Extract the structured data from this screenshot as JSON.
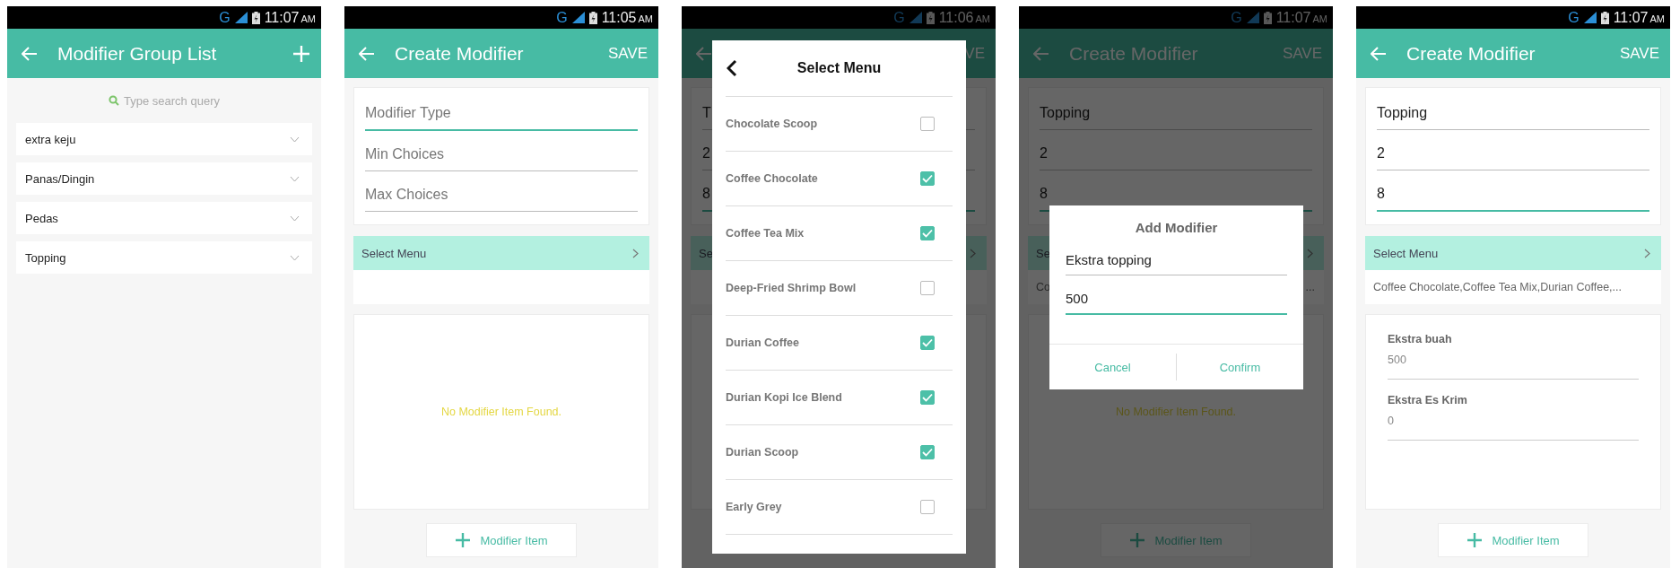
{
  "screens": [
    {
      "kind": "group_list",
      "status_bar": {
        "network": "G",
        "time": "11:07",
        "ampm": "AM"
      },
      "app_bar": {
        "title": "Modifier Group List",
        "action": {
          "kind": "add"
        }
      },
      "search": {
        "placeholder": "Type search query"
      },
      "groups": [
        {
          "name": "extra keju"
        },
        {
          "name": "Panas/Dingin"
        },
        {
          "name": "Pedas"
        },
        {
          "name": "Topping"
        }
      ]
    },
    {
      "kind": "form",
      "status_bar": {
        "network": "G",
        "time": "11:05",
        "ampm": "AM"
      },
      "app_bar": {
        "title": "Create Modifier",
        "action": {
          "kind": "text",
          "label": "SAVE"
        }
      },
      "fields": [
        {
          "placeholder": "Modifier Type",
          "focused": true
        },
        {
          "placeholder": "Min Choices",
          "focused": false
        },
        {
          "placeholder": "Max Choices",
          "focused": false
        }
      ],
      "select_menu": {
        "label": "Select Menu"
      },
      "empty_message": "No Modifier Item Found.",
      "add_button": "Modifier Item"
    },
    {
      "kind": "form",
      "status_bar": {
        "network": "G",
        "time": "11:06",
        "ampm": "AM"
      },
      "app_bar": {
        "action": {
          "kind": "text",
          "label": "VE"
        }
      },
      "fields": [
        {
          "value": "T",
          "focused": false
        },
        {
          "value": "2",
          "focused": false
        },
        {
          "value": "8",
          "focused": true
        }
      ],
      "select_menu": {
        "label": "Se"
      },
      "dialog": {
        "kind": "select_menu",
        "title": "Select Menu",
        "items": [
          {
            "name": "Chocolate Scoop",
            "checked": false
          },
          {
            "name": "Coffee Chocolate",
            "checked": true
          },
          {
            "name": "Coffee Tea Mix",
            "checked": true
          },
          {
            "name": "Deep-Fried Shrimp Bowl",
            "checked": false
          },
          {
            "name": "Durian Coffee",
            "checked": true
          },
          {
            "name": "Durian Kopi Ice Blend",
            "checked": true
          },
          {
            "name": "Durian Scoop",
            "checked": true
          },
          {
            "name": "Early Grey",
            "checked": false
          }
        ]
      }
    },
    {
      "kind": "form",
      "status_bar": {
        "network": "G",
        "time": "11:07",
        "ampm": "AM"
      },
      "app_bar": {
        "title": "Create Modifier",
        "action": {
          "kind": "text",
          "label": "SAVE"
        }
      },
      "fields": [
        {
          "value": "Topping",
          "focused": false
        },
        {
          "value": "2",
          "focused": false
        },
        {
          "value": "8",
          "focused": true
        }
      ],
      "select_menu": {
        "label": "Se",
        "summary": [
          "Co",
          "..."
        ]
      },
      "empty_message": "No Modifier Item Found.",
      "add_button": "Modifier Item",
      "dialog": {
        "kind": "add_modifier",
        "title": "Add Modifier",
        "fields": [
          {
            "value": "Ekstra topping",
            "focused": false
          },
          {
            "value": "500",
            "focused": true
          }
        ],
        "buttons": [
          "Cancel",
          "Confirm"
        ]
      }
    },
    {
      "kind": "form",
      "status_bar": {
        "network": "G",
        "time": "11:07",
        "ampm": "AM"
      },
      "app_bar": {
        "title": "Create Modifier",
        "action": {
          "kind": "text",
          "label": "SAVE"
        }
      },
      "fields": [
        {
          "value": "Topping",
          "focused": false
        },
        {
          "value": "2",
          "focused": false
        },
        {
          "value": "8",
          "focused": true
        }
      ],
      "select_menu": {
        "label": "Select Menu",
        "summary": [
          "Coffee Chocolate,Coffee Tea Mix,Durian Coffee,..."
        ]
      },
      "items": [
        {
          "name": "Ekstra buah",
          "price": "500"
        },
        {
          "name": "Ekstra Es Krim",
          "price": "0"
        }
      ],
      "add_button": "Modifier Item"
    }
  ]
}
